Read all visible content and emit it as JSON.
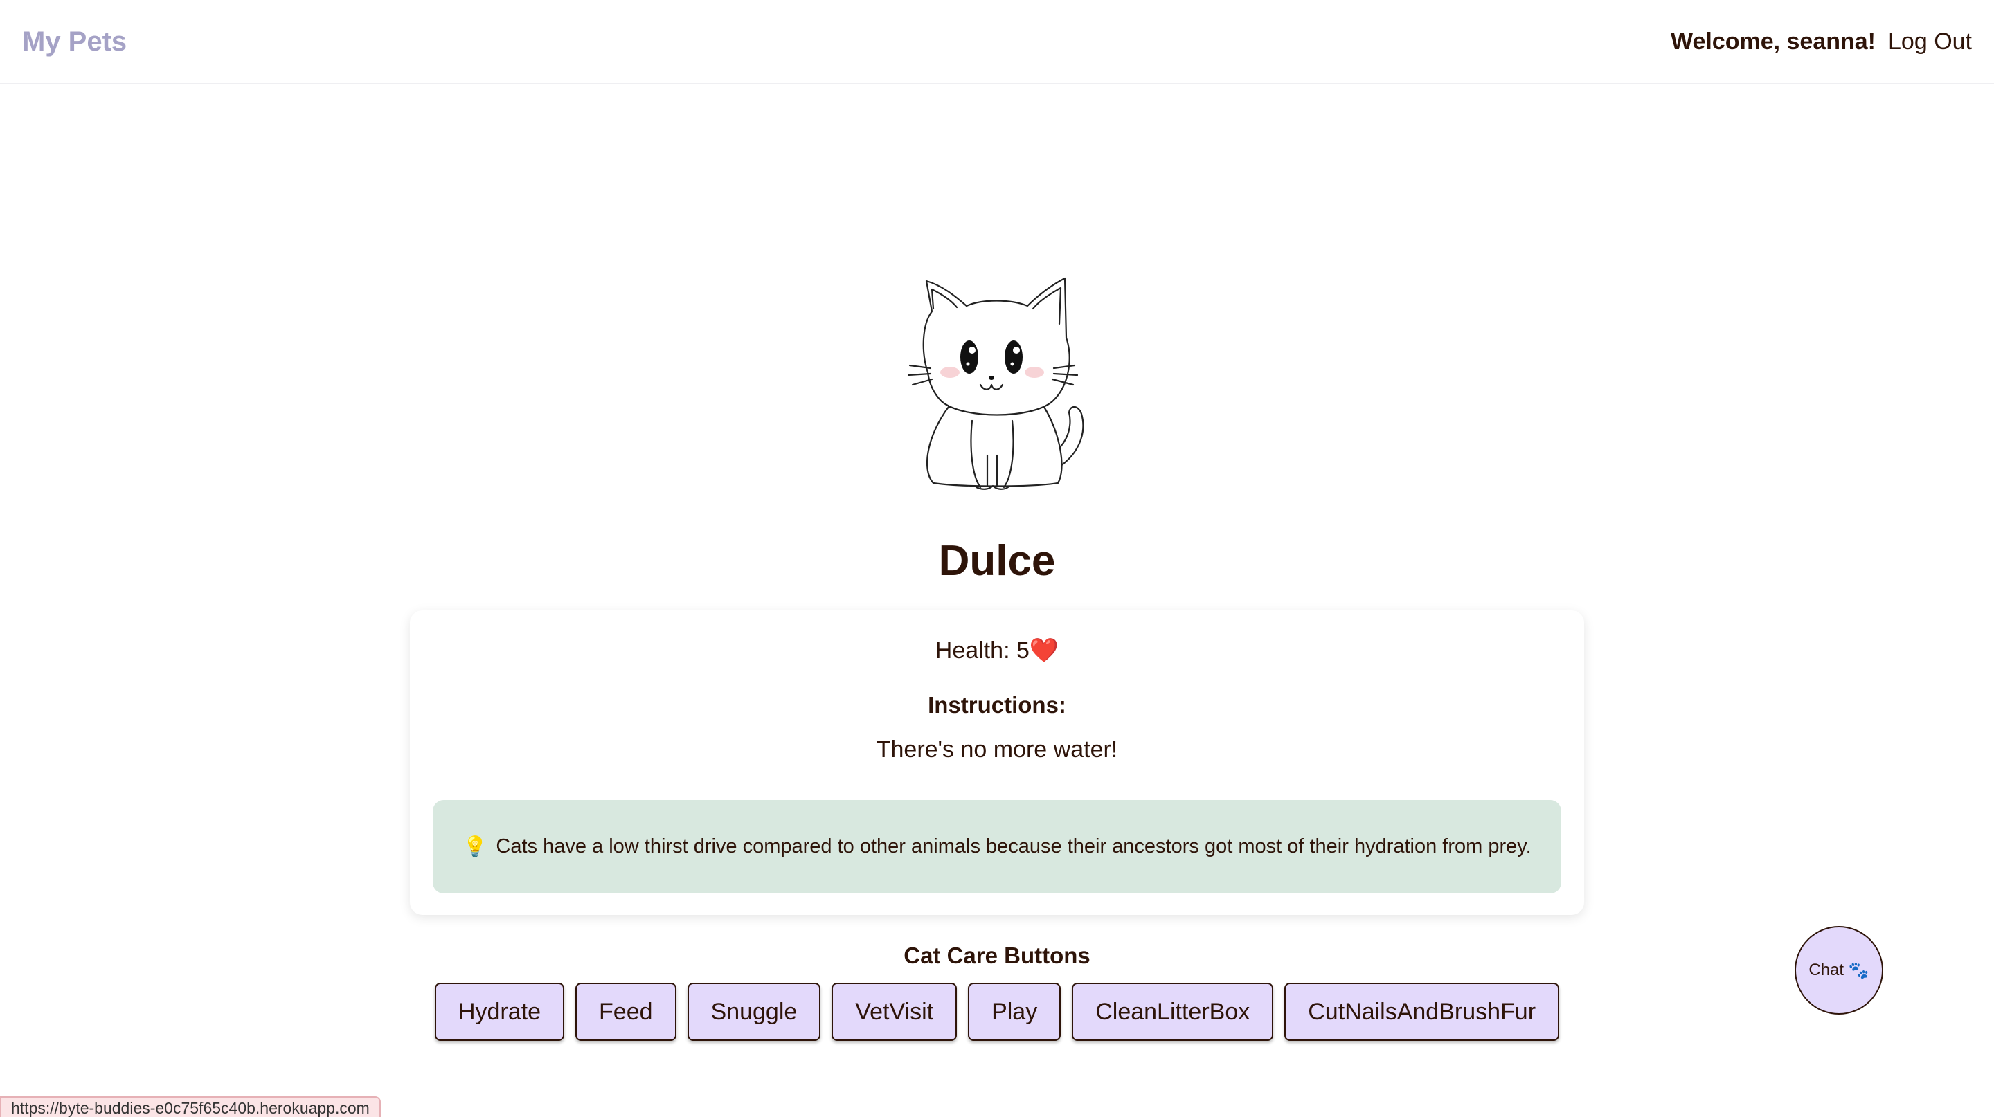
{
  "nav": {
    "brand": "My Pets",
    "welcome": "Welcome, seanna!",
    "logout": "Log Out"
  },
  "pet": {
    "image_icon": "cat-illustration",
    "name": "Dulce",
    "health_label": "Health: 5",
    "health_icon": "❤️",
    "instructions_heading": "Instructions:",
    "instructions_text": "There's no more water!",
    "fact_icon": "💡",
    "fact_text": "Cats have a low thirst drive compared to other animals because their ancestors got most of their hydration from prey."
  },
  "care": {
    "title": "Cat Care Buttons",
    "buttons": [
      "Hydrate",
      "Feed",
      "Snuggle",
      "VetVisit",
      "Play",
      "CleanLitterBox",
      "CutNailsAndBrushFur"
    ]
  },
  "chat": {
    "label": "Chat",
    "icon": "🐾"
  },
  "status_bar": {
    "url": "https://byte-buddies-e0c75f65c40b.herokuapp.com"
  },
  "colors": {
    "text": "#2e1409",
    "brand": "#a5a2c6",
    "button_bg": "#e3d9fb",
    "fact_bg": "#d8e8df"
  }
}
